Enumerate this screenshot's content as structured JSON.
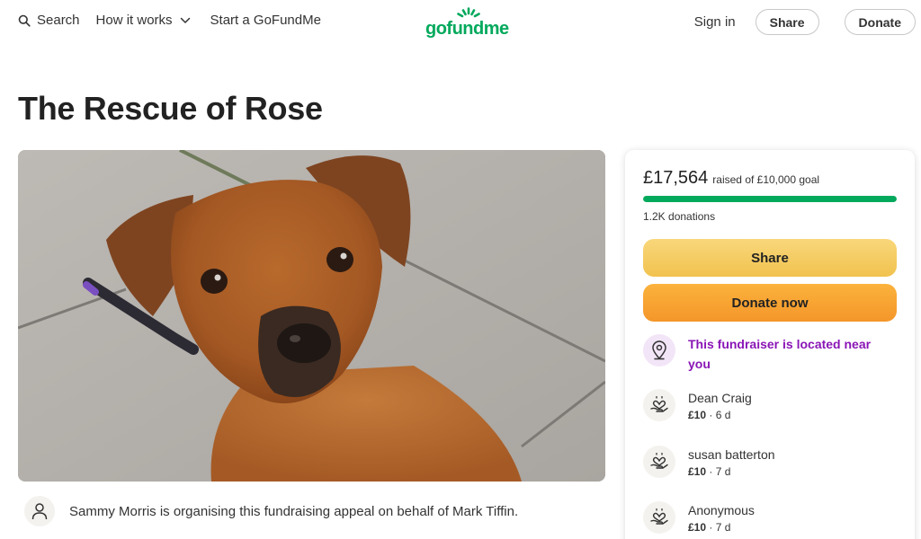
{
  "header": {
    "search_label": "Search",
    "how_it_works_label": "How it works",
    "start_label": "Start a GoFundMe",
    "logo_text": "gofundme",
    "signin_label": "Sign in",
    "share_label": "Share",
    "donate_label": "Donate"
  },
  "campaign": {
    "title": "The Rescue of Rose",
    "organiser_text": "Sammy Morris is organising this fundraising appeal on behalf of Mark Tiffin."
  },
  "panel": {
    "raised_amount": "£17,564",
    "raised_goal_text": "raised of £10,000 goal",
    "progress_fraction": 1.0,
    "donations_count": "1.2K donations",
    "share_button": "Share",
    "donate_button": "Donate now",
    "location_text": "This fundraiser is located near you",
    "donors": [
      {
        "name": "Dean Craig",
        "amount": "£10",
        "time": "· 6 d"
      },
      {
        "name": "susan batterton",
        "amount": "£10",
        "time": "· 7 d"
      },
      {
        "name": "Anonymous",
        "amount": "£10",
        "time": "· 7 d"
      }
    ]
  },
  "colors": {
    "brand_green": "#02a95c",
    "share_yellow": "#f1c24e",
    "donate_orange": "#f4962a",
    "location_purple": "#8a15b6"
  }
}
